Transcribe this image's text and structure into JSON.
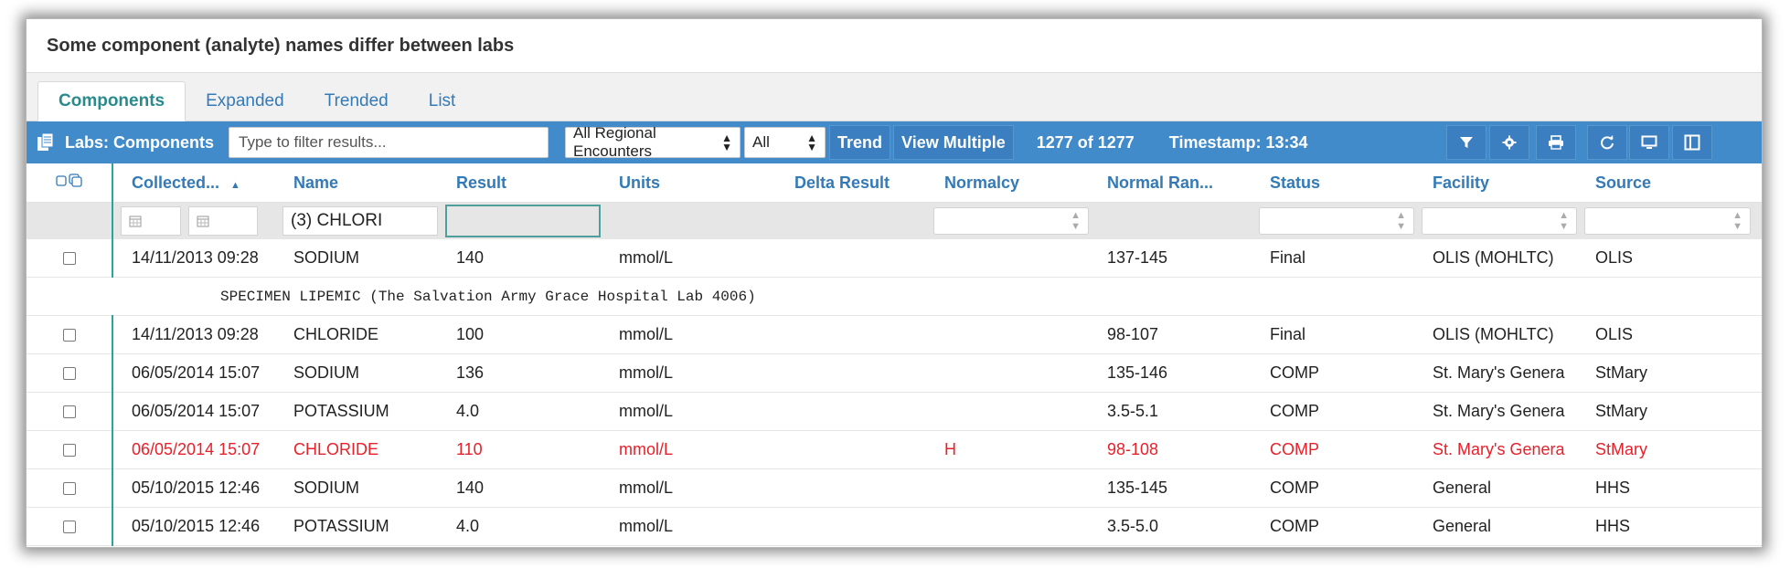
{
  "window": {
    "title": "Some component (analyte) names differ between labs"
  },
  "tabs": [
    {
      "label": "Components",
      "active": true
    },
    {
      "label": "Expanded",
      "active": false
    },
    {
      "label": "Trended",
      "active": false
    },
    {
      "label": "List",
      "active": false
    }
  ],
  "toolbar": {
    "title": "Labs: Components",
    "filter_placeholder": "Type to filter results...",
    "encounters_select": "All Regional Encounters",
    "scope_select": "All",
    "trend_label": "Trend",
    "view_multiple_label": "View Multiple",
    "count": "1277 of 1277",
    "timestamp": "Timestamp: 13:34",
    "icons": [
      "filter-icon",
      "gear-icon",
      "print-icon",
      "refresh-icon",
      "monitor-icon",
      "columns-icon"
    ],
    "accent": "#428bca"
  },
  "table": {
    "columns": [
      "Collected...",
      "Name",
      "Result",
      "Units",
      "Delta Result",
      "Normalcy",
      "Normal Ran...",
      "Status",
      "Facility",
      "Source"
    ],
    "name_filter": "(3) CHLORI",
    "rows": [
      {
        "collected": "14/11/2013 09:28",
        "name": "SODIUM",
        "result": "140",
        "units": "mmol/L",
        "delta": "",
        "normalcy": "",
        "range": "137-145",
        "status": "Final",
        "facility": "OLIS (MOHLTC)",
        "source": "OLIS"
      },
      {
        "note": "SPECIMEN LIPEMIC (The Salvation Army Grace Hospital Lab 4006)"
      },
      {
        "collected": "14/11/2013 09:28",
        "name": "CHLORIDE",
        "result": "100",
        "units": "mmol/L",
        "delta": "",
        "normalcy": "",
        "range": "98-107",
        "status": "Final",
        "facility": "OLIS (MOHLTC)",
        "source": "OLIS"
      },
      {
        "collected": "06/05/2014 15:07",
        "name": "SODIUM",
        "result": "136",
        "units": "mmol/L",
        "delta": "",
        "normalcy": "",
        "range": "135-146",
        "status": "COMP",
        "facility": "St. Mary's Genera",
        "source": "StMary"
      },
      {
        "collected": "06/05/2014 15:07",
        "name": "POTASSIUM",
        "result": "4.0",
        "units": "mmol/L",
        "delta": "",
        "normalcy": "",
        "range": "3.5-5.1",
        "status": "COMP",
        "facility": "St. Mary's Genera",
        "source": "StMary"
      },
      {
        "collected": "06/05/2014 15:07",
        "name": "CHLORIDE",
        "result": "110",
        "units": "mmol/L",
        "delta": "",
        "normalcy": "H",
        "range": "98-108",
        "status": "COMP",
        "facility": "St. Mary's Genera",
        "source": "StMary",
        "abnormal": true
      },
      {
        "collected": "05/10/2015 12:46",
        "name": "SODIUM",
        "result": "140",
        "units": "mmol/L",
        "delta": "",
        "normalcy": "",
        "range": "135-145",
        "status": "COMP",
        "facility": "General",
        "source": "HHS"
      },
      {
        "collected": "05/10/2015 12:46",
        "name": "POTASSIUM",
        "result": "4.0",
        "units": "mmol/L",
        "delta": "",
        "normalcy": "",
        "range": "3.5-5.0",
        "status": "COMP",
        "facility": "General",
        "source": "HHS"
      }
    ],
    "abnormal_color": "#e8202a",
    "link_color": "#337ab7"
  }
}
